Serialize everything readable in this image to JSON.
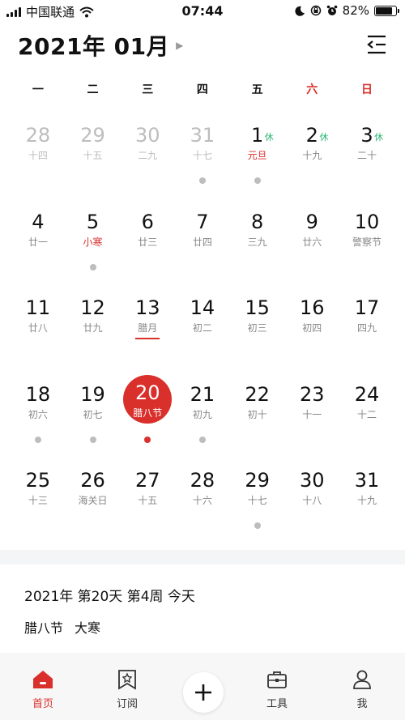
{
  "status_bar": {
    "carrier": "中国联通",
    "time": "07:44",
    "battery": "82%",
    "battery_level": 0.82
  },
  "header": {
    "title": "2021年 01月"
  },
  "weekdays": [
    "一",
    "二",
    "三",
    "四",
    "五",
    "六",
    "日"
  ],
  "calendar": {
    "rows": [
      [
        {
          "day": "28",
          "lunar": "十四",
          "gray": true
        },
        {
          "day": "29",
          "lunar": "十五",
          "gray": true
        },
        {
          "day": "30",
          "lunar": "二九",
          "gray": true
        },
        {
          "day": "31",
          "lunar": "十七",
          "gray": true,
          "dot": true
        },
        {
          "day": "1",
          "lunar": "元旦",
          "lunar_red": true,
          "rest": "休",
          "dot": true
        },
        {
          "day": "2",
          "lunar": "十九",
          "rest": "休"
        },
        {
          "day": "3",
          "lunar": "二十",
          "rest": "休"
        }
      ],
      [
        {
          "day": "4",
          "lunar": "廿一"
        },
        {
          "day": "5",
          "lunar": "小寒",
          "lunar_red": true,
          "dot": true
        },
        {
          "day": "6",
          "lunar": "廿三"
        },
        {
          "day": "7",
          "lunar": "廿四"
        },
        {
          "day": "8",
          "lunar": "三九"
        },
        {
          "day": "9",
          "lunar": "廿六"
        },
        {
          "day": "10",
          "lunar": "警察节"
        }
      ],
      [
        {
          "day": "11",
          "lunar": "廿八"
        },
        {
          "day": "12",
          "lunar": "廿九"
        },
        {
          "day": "13",
          "lunar": "腊月",
          "underline": true
        },
        {
          "day": "14",
          "lunar": "初二"
        },
        {
          "day": "15",
          "lunar": "初三"
        },
        {
          "day": "16",
          "lunar": "初四"
        },
        {
          "day": "17",
          "lunar": "四九"
        }
      ],
      [
        {
          "day": "18",
          "lunar": "初六",
          "dot": true
        },
        {
          "day": "19",
          "lunar": "初七",
          "dot": true
        },
        {
          "day": "20",
          "lunar": "腊八节",
          "today": true,
          "dot": true,
          "dot_red": true
        },
        {
          "day": "21",
          "lunar": "初九",
          "dot": true
        },
        {
          "day": "22",
          "lunar": "初十"
        },
        {
          "day": "23",
          "lunar": "十一"
        },
        {
          "day": "24",
          "lunar": "十二"
        }
      ],
      [
        {
          "day": "25",
          "lunar": "十三"
        },
        {
          "day": "26",
          "lunar": "海关日"
        },
        {
          "day": "27",
          "lunar": "十五"
        },
        {
          "day": "28",
          "lunar": "十六"
        },
        {
          "day": "29",
          "lunar": "十七",
          "dot": true
        },
        {
          "day": "30",
          "lunar": "十八"
        },
        {
          "day": "31",
          "lunar": "十九"
        }
      ]
    ]
  },
  "info": {
    "date_summary": "2021年 第20天 第4周 今天",
    "festival": "腊八节",
    "solar_term": "大寒"
  },
  "tabbar": {
    "home": "首页",
    "subscribe": "订阅",
    "tools": "工具",
    "me": "我"
  },
  "colors": {
    "accent": "#d9302c",
    "rest_green": "#2bb673",
    "gray_text": "#888888",
    "dot_gray": "#bdbdbd"
  }
}
